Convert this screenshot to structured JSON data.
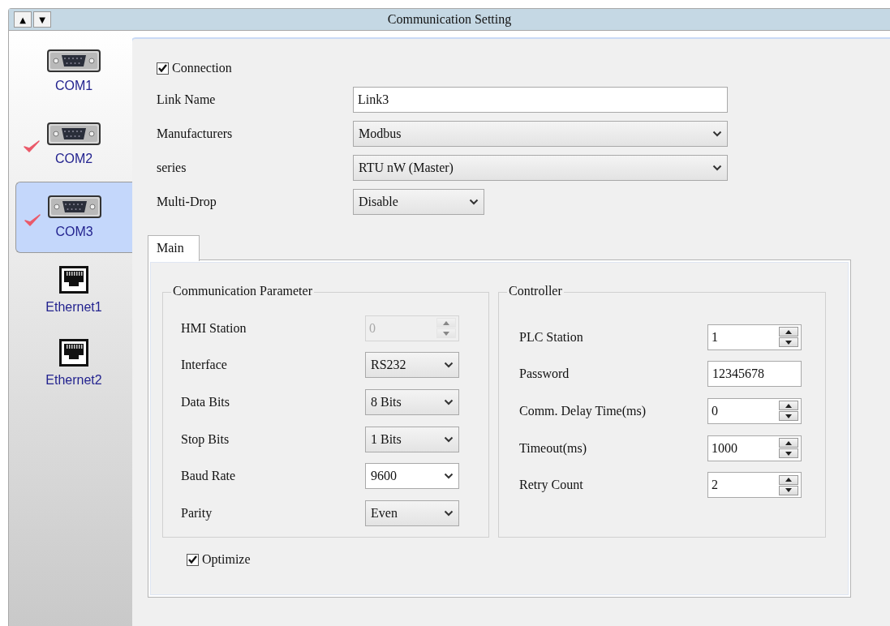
{
  "window": {
    "title": "Communication Setting",
    "buttons": [
      "▲",
      "▼"
    ]
  },
  "devices": [
    {
      "label": "COM1",
      "kind": "serial",
      "checked": false,
      "selected": false
    },
    {
      "label": "COM2",
      "kind": "serial",
      "checked": true,
      "selected": false
    },
    {
      "label": "COM3",
      "kind": "serial",
      "checked": true,
      "selected": true
    },
    {
      "label": "Ethernet1",
      "kind": "ethernet",
      "checked": false,
      "selected": false
    },
    {
      "label": "Ethernet2",
      "kind": "ethernet",
      "checked": false,
      "selected": false
    }
  ],
  "connection": {
    "label": "Connection",
    "checked": true
  },
  "fields": [
    {
      "label": "Link Name",
      "kind": "text",
      "value": "Link3"
    },
    {
      "label": "Manufacturers",
      "kind": "select",
      "value": "Modbus"
    },
    {
      "label": "series",
      "kind": "select",
      "value": "RTU nW (Master)"
    },
    {
      "label": "Multi-Drop",
      "kind": "select",
      "value": "Disable"
    }
  ],
  "tabs": [
    {
      "label": "Main",
      "selected": true
    }
  ],
  "groups": [
    {
      "title": "Communication Parameter",
      "fields": [
        {
          "label": "HMI Station",
          "kind": "spin",
          "value": "0",
          "disabled": true
        },
        {
          "label": "Interface",
          "kind": "select",
          "value": "RS232",
          "disabled": false
        },
        {
          "label": "Data Bits",
          "kind": "select",
          "value": "8 Bits",
          "disabled": false
        },
        {
          "label": "Stop Bits",
          "kind": "select",
          "value": "1 Bits",
          "disabled": false
        },
        {
          "label": "Baud Rate",
          "kind": "combo",
          "value": "9600",
          "disabled": false
        },
        {
          "label": "Parity",
          "kind": "select",
          "value": "Even",
          "disabled": false
        }
      ]
    },
    {
      "title": "Controller",
      "fields": [
        {
          "label": "PLC Station",
          "kind": "spin",
          "value": "1",
          "disabled": false
        },
        {
          "label": "Password",
          "kind": "text",
          "value": "12345678",
          "disabled": false
        },
        {
          "label": "Comm. Delay Time(ms)",
          "kind": "spin",
          "value": "0",
          "disabled": false
        },
        {
          "label": "Timeout(ms)",
          "kind": "spin",
          "value": "1000",
          "disabled": false
        },
        {
          "label": "Retry Count",
          "kind": "spin",
          "value": "2",
          "disabled": false
        }
      ]
    }
  ],
  "optimize": {
    "label": "Optimize",
    "checked": true
  }
}
